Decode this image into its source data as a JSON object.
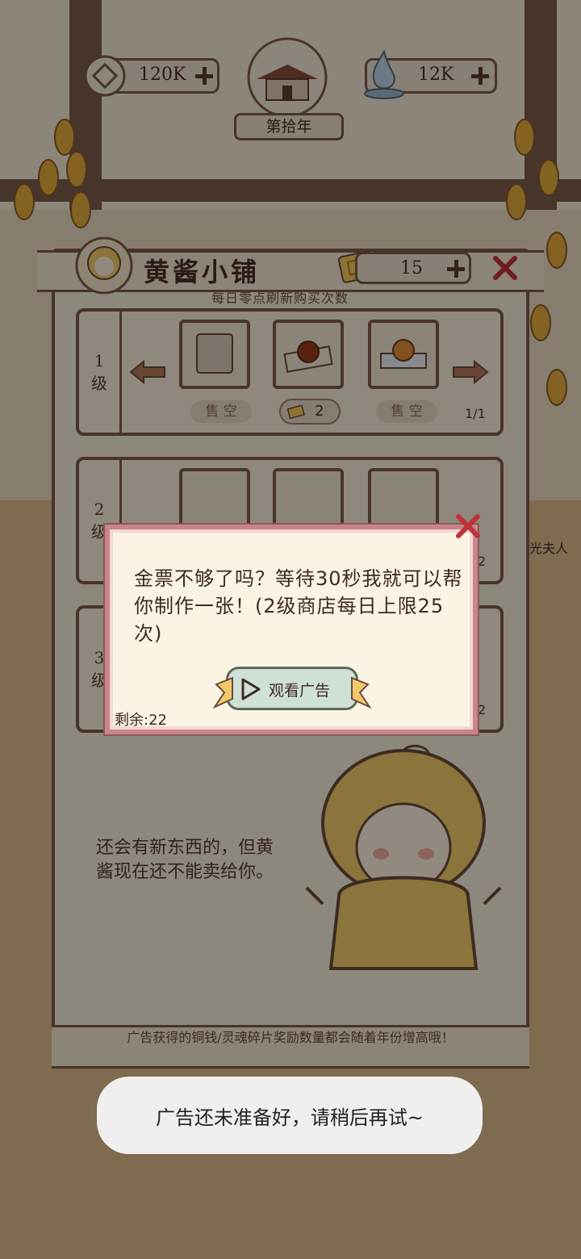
{
  "top_bar": {
    "coins": "120K",
    "soul": "12K",
    "year": "第拾年"
  },
  "shop": {
    "title": "黄酱小铺",
    "ticket_count": "15",
    "subtitle": "每日零点刷新购买次数",
    "rows": [
      {
        "level": "1\n级",
        "items": [
          {
            "status": "售 空"
          },
          {
            "price": "2"
          },
          {
            "status": "售 空"
          }
        ],
        "page": "1/1"
      },
      {
        "level": "2\n级",
        "page": "2"
      },
      {
        "level": "3\n级",
        "page": "2"
      }
    ],
    "mascot_text": "还会有新东西的，但黄酱现在还不能卖给你。",
    "footer_text": "广告获得的铜钱/灵魂碎片奖励数量都会随着年份增高哦！"
  },
  "side_label": "光夫人",
  "dialog": {
    "message": "金票不够了吗？等待30秒我就可以帮你制作一张！(2级商店每日上限25次)",
    "watch_ad_label": "观看广告",
    "remaining": "剩余:22"
  },
  "toast": "广告还未准备好，请稍后再试~",
  "colors": {
    "frame": "#7d5a4c",
    "parchment": "#f3ead9",
    "dialog_border": "#c9848c",
    "ad_button": "#cfe0d6",
    "close": "#c0313b"
  }
}
